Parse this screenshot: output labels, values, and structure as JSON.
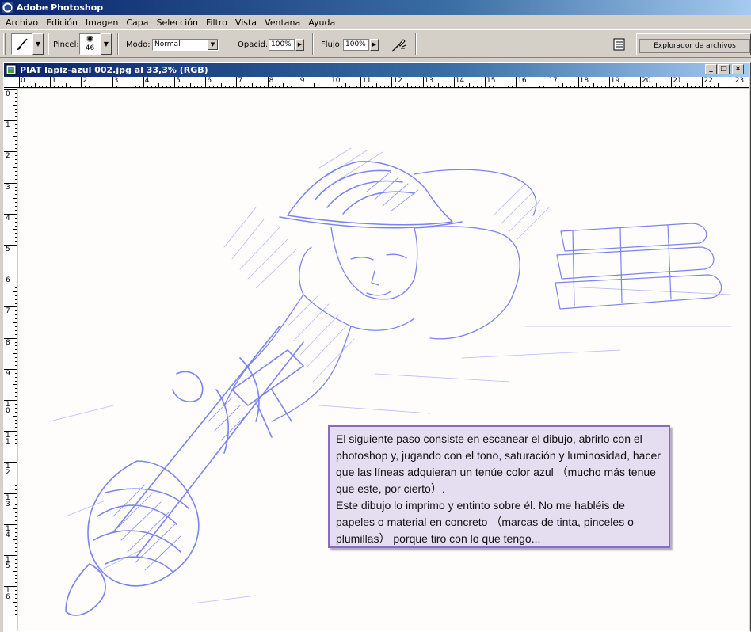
{
  "app": {
    "title": "Adobe Photoshop"
  },
  "menu": [
    "Archivo",
    "Edición",
    "Imagen",
    "Capa",
    "Selección",
    "Filtro",
    "Vista",
    "Ventana",
    "Ayuda"
  ],
  "options": {
    "brush_label": "Pincel:",
    "brush_size": "46",
    "mode_label": "Modo:",
    "mode_value": "Normal",
    "opacity_label": "Opacid.:",
    "opacity_value": "100%",
    "flow_label": "Flujo:",
    "flow_value": "100%",
    "file_browser": "Explorador de archivos"
  },
  "document": {
    "title": "PIAT lapiz-azul 002.jpg al 33,3% (RGB)",
    "ruler_top": [
      "0",
      "1",
      "2",
      "3",
      "4",
      "5",
      "6",
      "7",
      "8",
      "9",
      "10",
      "11",
      "12",
      "13",
      "14",
      "15",
      "16",
      "17",
      "18",
      "19",
      "20",
      "21",
      "22",
      "23"
    ],
    "ruler_left": [
      "0",
      "1",
      "2",
      "3",
      "4",
      "5",
      "6",
      "7",
      "8",
      "9",
      "10",
      "11",
      "12",
      "13",
      "14",
      "15",
      "16"
    ]
  },
  "caption": {
    "paragraph1": "El siguiente paso consiste en escanear el dibujo, abrirlo con el photoshop y, jugando con el tono, saturación y luminosidad, hacer que las líneas adquieran un tenúe color azul （mucho más tenue que este, por cierto）.",
    "paragraph2": "Este dibujo lo imprimo y entinto sobre él. No me habléis de papeles o material en concreto （marcas de tinta, pinceles o plumillas） porque tiro con lo que tengo..."
  },
  "colors": {
    "sketch": "#7b83f0",
    "caption_border": "#8a6bbf",
    "caption_bg": "#e4def0"
  }
}
